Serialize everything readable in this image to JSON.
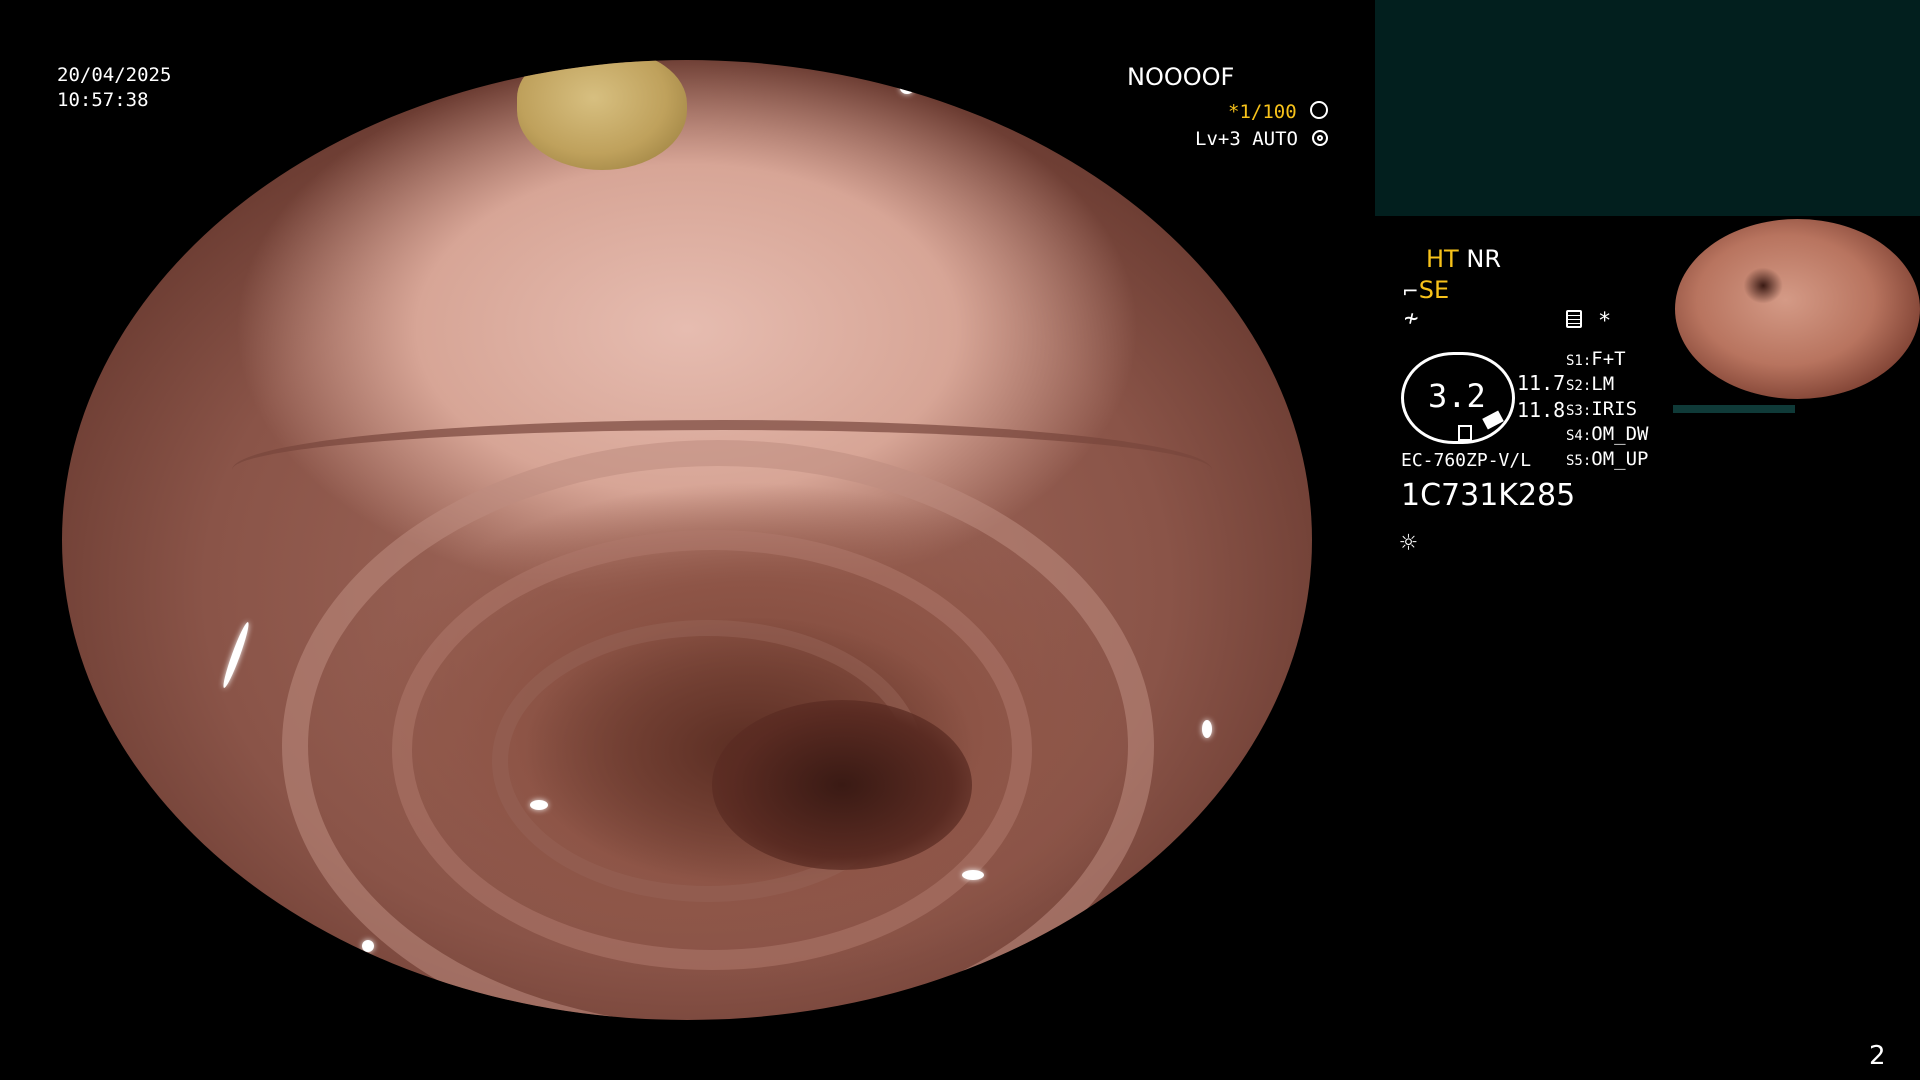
{
  "overlay": {
    "date": "20/04/2025",
    "time": "10:57:38",
    "patient_code": "NOOOOF",
    "shutter": "*1/100",
    "level": "Lv+3 AUTO"
  },
  "panel": {
    "modes_line1_ht": "HT",
    "modes_line1_nr": "NR",
    "modes_line2": "SE",
    "zoom_value": "3.2",
    "zoom_value_top": "11.7",
    "zoom_value_bottom": "11.8",
    "scope_model": "EC-760ZP-V/L",
    "scope_serial": "1C731K285",
    "star": "*",
    "switches": [
      {
        "key": "S1:",
        "val": "F+T"
      },
      {
        "key": "S2:",
        "val": "LM"
      },
      {
        "key": "S3:",
        "val": "IRIS"
      },
      {
        "key": "S4:",
        "val": "OM_DW"
      },
      {
        "key": "S5:",
        "val": "OM_UP"
      }
    ]
  },
  "page_number": "2",
  "colors": {
    "accent": "#f7c21a",
    "panel_bg": "#021f1e"
  },
  "icons": [
    "shutter-icon",
    "iris-icon",
    "stiffness-icon",
    "freeze-icon",
    "memory-icon",
    "light-icon"
  ]
}
